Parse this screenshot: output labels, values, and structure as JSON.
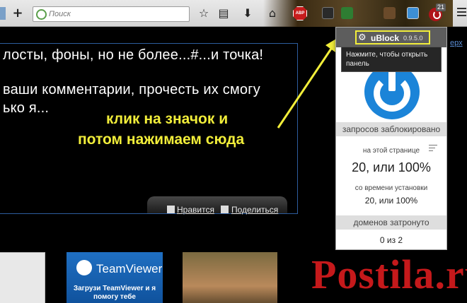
{
  "toolbar": {
    "new_tab_glyph": "+",
    "search_placeholder": "Поиск",
    "abp_label": "ABP",
    "ublock_badge": "21"
  },
  "page": {
    "line1": "лосты, фоны, но не более...#...и точка!",
    "line2": "ваши комментарии, прочесть их смогу",
    "line3": "ько я...",
    "share_like": "Нравится",
    "share_share": "Поделиться",
    "edge_link": "ерх",
    "teamviewer_title": "TeamViewer",
    "teamviewer_sub": "Загрузи TeamViewer и я помогу тебе"
  },
  "annotation": {
    "line1": "клик на значок и",
    "line2": "потом нажимаем сюда",
    "color": "#f2ee3a"
  },
  "popup": {
    "name": "uBlock",
    "version": "0.9.5.0",
    "tooltip": "Нажмите, чтобы открыть панель",
    "requests_blocked_header": "запросов заблокировано",
    "on_this_page_label": "на этой странице",
    "on_this_page_value": "20, или 100%",
    "since_install_label": "со времени установки",
    "since_install_value": "20, или 100%",
    "domains_header": "доменов затронуто",
    "domains_value": "0 из 2",
    "power_color": "#1b84d8"
  },
  "watermark": {
    "text": "Postila.ru",
    "color": "#c5191b"
  }
}
